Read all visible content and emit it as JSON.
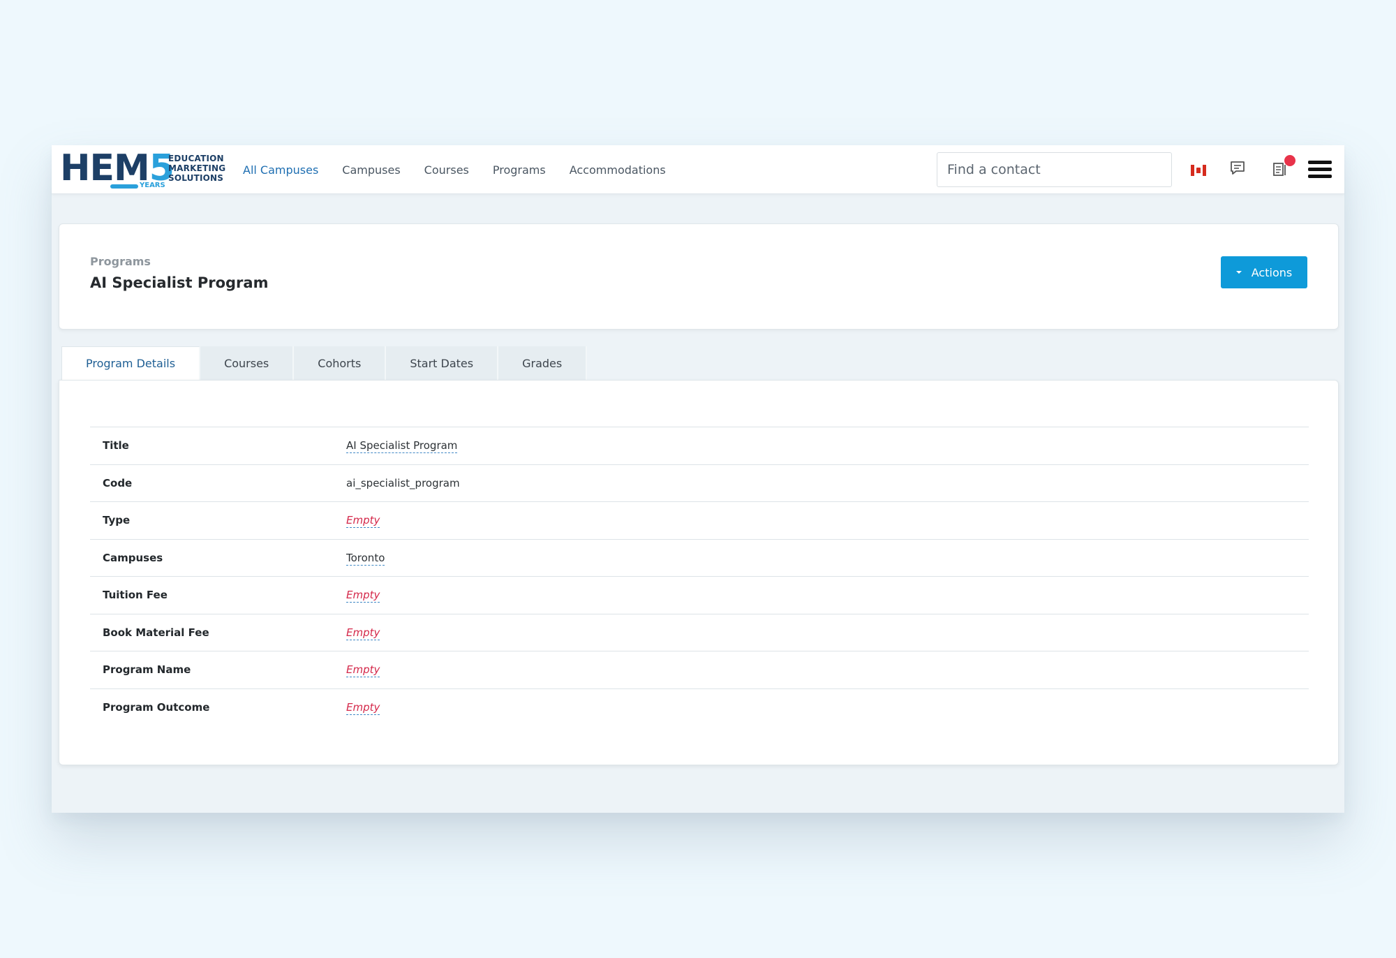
{
  "brand": {
    "logo_main": "HEM",
    "logo_digit": "5",
    "logo_lines": [
      "EDUCATION",
      "MARKETING",
      "SOLUTIONS"
    ],
    "logo_years": "YEARS"
  },
  "nav": {
    "items": [
      {
        "label": "All Campuses",
        "active": true
      },
      {
        "label": "Campuses",
        "active": false
      },
      {
        "label": "Courses",
        "active": false
      },
      {
        "label": "Programs",
        "active": false
      },
      {
        "label": "Accommodations",
        "active": false
      }
    ]
  },
  "search": {
    "placeholder": "Find a contact",
    "value": ""
  },
  "header_icons": {
    "flag": "canada-flag-icon",
    "chat": "chat-icon",
    "docs": "documents-icon",
    "menu": "hamburger-menu-icon",
    "notification_color": "#e8334a"
  },
  "page": {
    "breadcrumb": "Programs",
    "title": "AI Specialist Program",
    "actions_label": "Actions",
    "accent": "#0e9ad9"
  },
  "tabs": [
    {
      "label": "Program Details",
      "active": true
    },
    {
      "label": "Courses",
      "active": false
    },
    {
      "label": "Cohorts",
      "active": false
    },
    {
      "label": "Start Dates",
      "active": false
    },
    {
      "label": "Grades",
      "active": false
    }
  ],
  "details": [
    {
      "key": "Title",
      "value": "AI Specialist Program",
      "editable": true,
      "empty": false
    },
    {
      "key": "Code",
      "value": "ai_specialist_program",
      "editable": false,
      "empty": false
    },
    {
      "key": "Type",
      "value": "Empty",
      "editable": true,
      "empty": true
    },
    {
      "key": "Campuses",
      "value": "Toronto",
      "editable": true,
      "empty": false
    },
    {
      "key": "Tuition Fee",
      "value": "Empty",
      "editable": true,
      "empty": true
    },
    {
      "key": "Book Material Fee",
      "value": "Empty",
      "editable": true,
      "empty": true
    },
    {
      "key": "Program Name",
      "value": "Empty",
      "editable": true,
      "empty": true
    },
    {
      "key": "Program Outcome",
      "value": "Empty",
      "editable": true,
      "empty": true
    }
  ]
}
